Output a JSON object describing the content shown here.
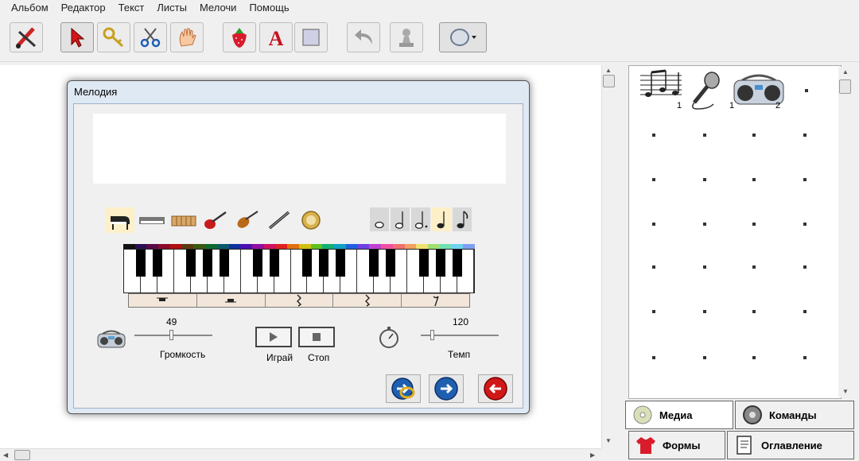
{
  "menu": [
    "Альбом",
    "Редактор",
    "Текст",
    "Листы",
    "Мелочи",
    "Помощь"
  ],
  "toolbar": {
    "icons": [
      "brush-icon",
      "arrow-cursor-icon",
      "key-icon",
      "scissors-icon",
      "hand-icon",
      "strawberry-icon",
      "text-a-icon",
      "rectangle-icon",
      "undo-icon",
      "stamp-icon",
      "ellipse-icon"
    ]
  },
  "dialog": {
    "title": "Мелодия",
    "instruments": [
      "piano-icon",
      "synth-icon",
      "xylophone-icon",
      "electric-guitar-icon",
      "violin-icon",
      "flute-icon",
      "banjo-icon"
    ],
    "durations": [
      "whole-note-icon",
      "half-note-icon",
      "dotted-half-note-icon",
      "quarter-note-icon",
      "eighth-note-icon"
    ],
    "volume": {
      "value": "49",
      "label": "Громкость"
    },
    "tempo": {
      "value": "120",
      "label": "Темп"
    },
    "play_label": "Играй",
    "stop_label": "Стоп"
  },
  "media": {
    "items": [
      {
        "icon": "sheet-music-icon",
        "count": ""
      },
      {
        "icon": "microphone-icon",
        "count": "1"
      },
      {
        "icon": "boombox-icon",
        "count": "1"
      },
      {
        "icon": "",
        "count": "2"
      }
    ]
  },
  "tabs": {
    "media": "Медиа",
    "commands": "Команды",
    "forms": "Формы",
    "contents": "Оглавление"
  },
  "colors": {
    "accent_red": "#cc1111",
    "accent_blue": "#1f5fb0",
    "selected_bg": "#fdf0c8"
  }
}
